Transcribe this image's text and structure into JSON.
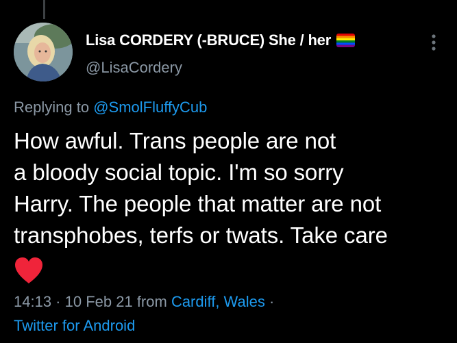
{
  "author": {
    "display_name": "Lisa CORDERY (-BRUCE) She / her",
    "handle": "@LisaCordery",
    "avatar_icon": "profile-photo",
    "flag_icon": "rainbow-flag-icon"
  },
  "reply": {
    "prefix": "Replying to",
    "mention": "@SmolFluffyCub"
  },
  "tweet": {
    "lines": [
      "How awful. Trans people are not",
      "a bloody social topic. I'm so sorry",
      "Harry. The people that matter are not",
      "transphobes, terfs or twats. Take care"
    ],
    "emoji": "red-heart-icon"
  },
  "meta": {
    "time": "14:13",
    "sep1": " · ",
    "date": "10 Feb 21",
    "from_label": " from ",
    "location": "Cardiff, Wales",
    "sep2": " ·",
    "source": "Twitter for Android"
  },
  "colors": {
    "background": "#000000",
    "text": "#ffffff",
    "secondary": "#8b98a5",
    "link": "#1d9bf0",
    "heart": "#f0243a"
  }
}
